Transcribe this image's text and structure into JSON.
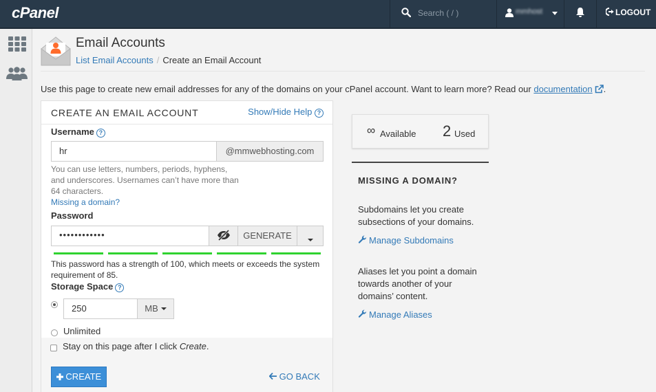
{
  "topbar": {
    "logo": "cPanel",
    "search_placeholder": "Search ( / )",
    "username": "mmhost",
    "logout_label": "LOGOUT"
  },
  "header": {
    "title": "Email Accounts",
    "breadcrumb_link": "List Email Accounts",
    "breadcrumb_sep": "/",
    "breadcrumb_current": "Create an Email Account"
  },
  "intro": {
    "text": "Use this page to create new email addresses for any of the domains on your cPanel account. Want to learn more? Read our ",
    "link": "documentation",
    "suffix": "."
  },
  "form": {
    "heading": "CREATE AN EMAIL ACCOUNT",
    "help_toggle": "Show/Hide Help",
    "username_label": "Username",
    "username_value": "hr",
    "domain_suffix": "@mmwebhosting.com",
    "username_help_1": "You can use letters, numbers, periods, hyphens,",
    "username_help_2": "and underscores. Usernames can’t have more than",
    "username_help_3": "64 characters.",
    "missing_domain_link": "Missing a domain?",
    "password_label": "Password",
    "password_value": "••••••••••••",
    "generate_label": "GENERATE",
    "strength_message": "This password has a strength of 100, which meets or exceeds the system requirement of 85.",
    "strength": 100,
    "storage_label": "Storage Space",
    "storage_value": "250",
    "storage_unit": "MB",
    "unlimited_label": "Unlimited",
    "stay_prefix": "Stay on this page after I click ",
    "stay_em": "Create",
    "stay_suffix": ".",
    "create_label": "CREATE",
    "goback_label": "GO BACK"
  },
  "stats": {
    "available_symbol": "∞",
    "available_label": "Available",
    "used_count": "2",
    "used_label": "Used"
  },
  "sidebar_help": {
    "title": "MISSING A DOMAIN?",
    "subdomains_text": "Subdomains let you create subsections of your domains.",
    "subdomains_link": "Manage Subdomains",
    "aliases_text": "Aliases let you point a domain towards another of your domains’ content.",
    "aliases_link": "Manage Aliases"
  },
  "colors": {
    "topbar": "#293a4a",
    "link": "#337ab7",
    "primary_button": "#3c8fd8",
    "strength_bar": "#2fd22f"
  }
}
